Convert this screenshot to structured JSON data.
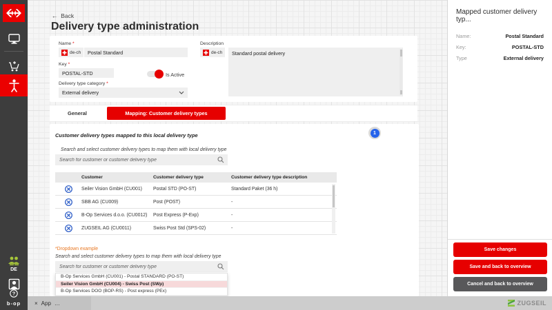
{
  "colors": {
    "accent_red": "#e60000",
    "sidebar_gray": "#3d3d3d",
    "badge_blue": "#2563eb",
    "delete_icon_blue": "#2255c4",
    "highlight_pink": "#f7d9da",
    "dropdown_label_orange": "#e87722",
    "users_icon_green": "#a6c53a"
  },
  "sidebar": {
    "lang": "DE",
    "brand_bottom": "b-op",
    "icons": [
      "sbb-logo",
      "monitor",
      "cart-add",
      "accessibility-person",
      "users-green",
      "avatar",
      "help"
    ]
  },
  "header": {
    "back_label": "Back",
    "title": "Delivery type administration"
  },
  "form": {
    "required_mark": "*",
    "name_label": "Name",
    "lang_chip": "de-ch",
    "name_value": "Postal Standard",
    "key_label": "Key",
    "key_value": "POSTAL-STD",
    "is_active_label": "Is Active",
    "category_label": "Delivery type category",
    "category_value": "External delivery",
    "description_label": "Description",
    "description_value": "Standard postal delivery"
  },
  "tabs": {
    "general": "General",
    "mapping": "Mapping: Customer delivery types"
  },
  "mapping": {
    "annotation_badge": "1",
    "section_title": "Customer delivery types mapped to this local delivery type",
    "search_caption": "Search and select customer delivery types to map them with local delivery type",
    "search_placeholder": "Search for customer or customer delivery type",
    "table": {
      "headers": [
        "Customer",
        "Customer delivery type",
        "Customer delivery type description"
      ],
      "rows": [
        {
          "customer": "Seiler Vision GmbH (CU001)",
          "type": "Postal STD (PO-ST)",
          "description": "Standard Paket (36 h)"
        },
        {
          "customer": "SBB AG (CU009)",
          "type": "Post (POST)",
          "description": "-"
        },
        {
          "customer": "B-Op Services d.o.o. (CU0012)",
          "type": "Post Express (P-Exp)",
          "description": "-"
        },
        {
          "customer": "ZUGSEIL AG (CU0011)",
          "type": "Swiss Post Std (SPS-02)",
          "description": "-"
        }
      ]
    },
    "dropdown": {
      "label": "*Dropdown example",
      "caption": "Search and select customer delivery types to map them with local delivery type",
      "placeholder": "Search for customer or customer delivery type",
      "options": [
        {
          "label": "B-Op Services GmbH (CU001) - Postal STANDARD (PO-ST)",
          "highlighted": false
        },
        {
          "label": "Seiler Vision GmbH (CU004) - Swiss Post (SWp)",
          "highlighted": true
        },
        {
          "label": "B-Op Services DOO (BOP-RS) - Post express (PEx)",
          "highlighted": false
        }
      ]
    }
  },
  "right_panel": {
    "title": "Mapped customer delivery typ...",
    "fields": [
      {
        "label": "Name:",
        "value": "Postal Standard"
      },
      {
        "label": "Key:",
        "value": "POSTAL-STD"
      },
      {
        "label": "Type",
        "value": "External delivery"
      }
    ],
    "buttons": {
      "save": "Save changes",
      "save_back": "Save and back to overview",
      "cancel_back": "Cancel and back to overview"
    }
  },
  "footer": {
    "app_tab_close": "×",
    "app_tab": "App",
    "brand": "ZUGSEIL"
  }
}
